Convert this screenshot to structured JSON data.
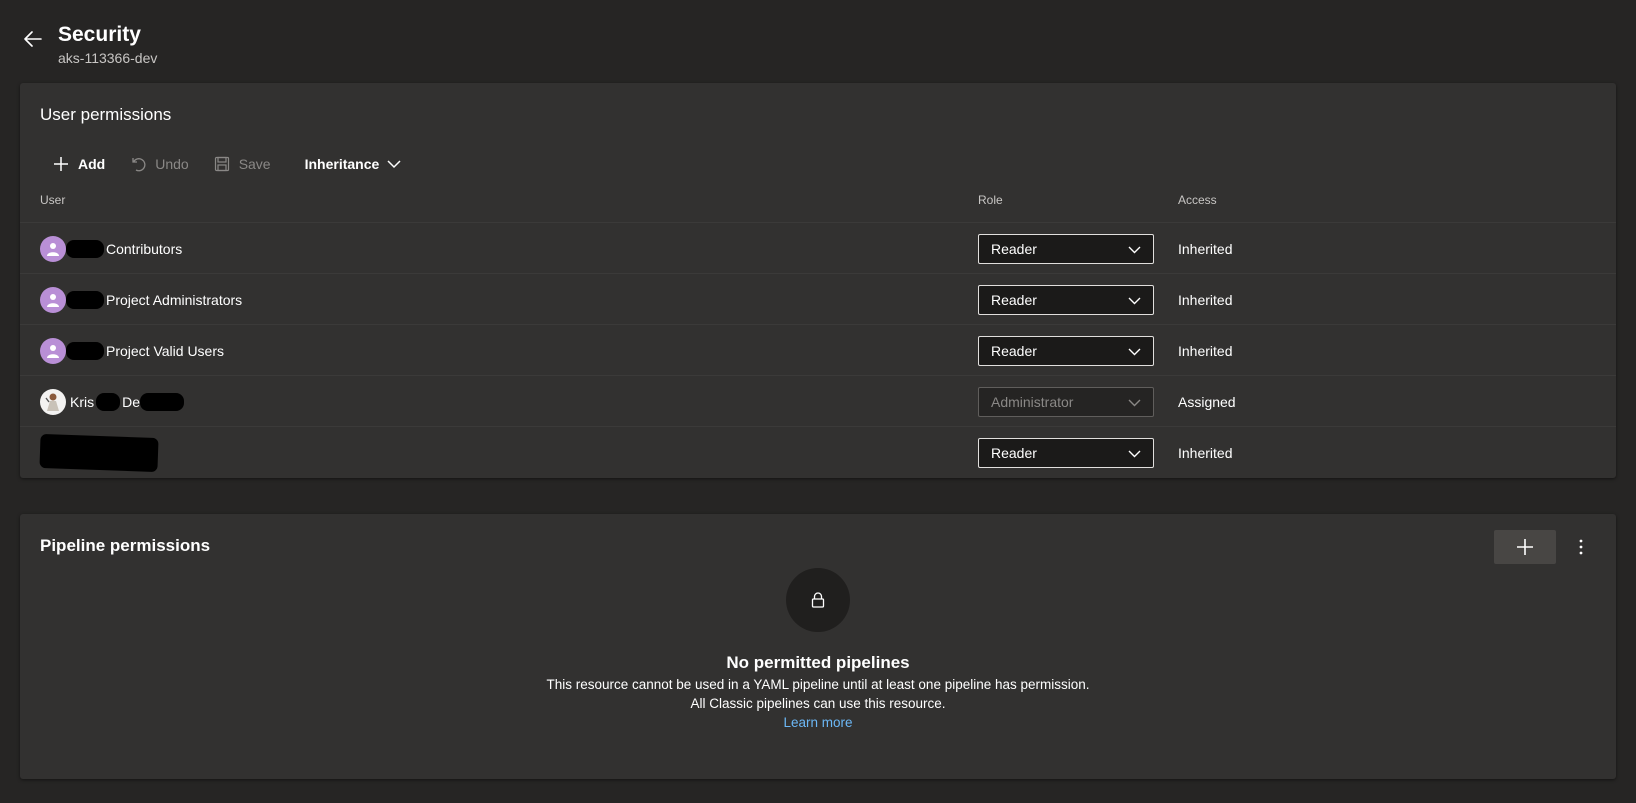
{
  "header": {
    "title": "Security",
    "subtitle": "aks-113366-dev"
  },
  "user_permissions": {
    "title": "User permissions",
    "toolbar": {
      "add_label": "Add",
      "undo_label": "Undo",
      "save_label": "Save",
      "inheritance_label": "Inheritance"
    },
    "columns": {
      "user": "User",
      "role": "Role",
      "access": "Access"
    },
    "rows": [
      {
        "name": "Contributors",
        "role": "Reader",
        "access": "Inherited",
        "avatar": "group-icon",
        "role_enabled": true
      },
      {
        "name": "Project Administrators",
        "role": "Reader",
        "access": "Inherited",
        "avatar": "group-icon",
        "role_enabled": true
      },
      {
        "name": "Project Valid Users",
        "role": "Reader",
        "access": "Inherited",
        "avatar": "group-icon",
        "role_enabled": true
      },
      {
        "name_part1": "Kris",
        "name_part2": "De",
        "role": "Administrator",
        "access": "Assigned",
        "avatar": "user-avatar",
        "role_enabled": false
      },
      {
        "name": "",
        "role": "Reader",
        "access": "Inherited",
        "avatar": "none",
        "role_enabled": true
      }
    ]
  },
  "pipeline_permissions": {
    "title": "Pipeline permissions",
    "empty_title": "No permitted pipelines",
    "empty_line1": "This resource cannot be used in a YAML pipeline until at least one pipeline has permission.",
    "empty_line2": "All Classic pipelines can use this resource.",
    "learn_more": "Learn more"
  },
  "colors": {
    "background": "#262524",
    "card": "#323130",
    "link": "#6cb8f6",
    "group_avatar": "#b98fd6"
  }
}
